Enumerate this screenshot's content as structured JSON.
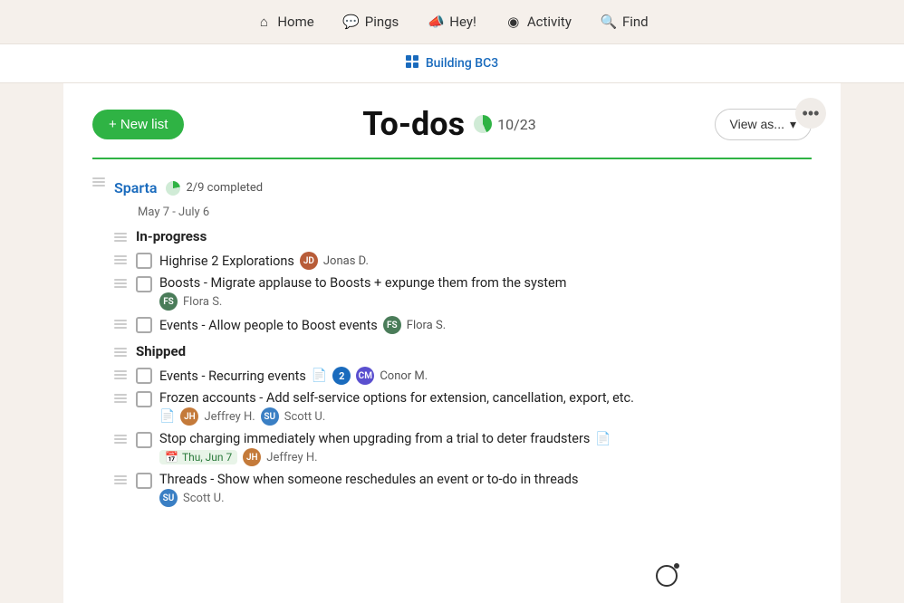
{
  "nav": {
    "items": [
      {
        "id": "home",
        "label": "Home",
        "icon": "home"
      },
      {
        "id": "pings",
        "label": "Pings",
        "icon": "pings"
      },
      {
        "id": "hey",
        "label": "Hey!",
        "icon": "hey"
      },
      {
        "id": "activity",
        "label": "Activity",
        "icon": "activity"
      },
      {
        "id": "find",
        "label": "Find",
        "icon": "find"
      }
    ]
  },
  "breadcrumb": {
    "label": "Building BC3",
    "href": "#"
  },
  "header": {
    "new_list_label": "+ New list",
    "title": "To-dos",
    "progress_text": "10/23",
    "view_as_label": "View as..."
  },
  "sparta": {
    "name": "Sparta",
    "progress_text": "2/9 completed",
    "date_range": "May 7 - July 6"
  },
  "sections": [
    {
      "id": "in-progress",
      "label": "In-progress",
      "items": [
        {
          "id": "item-1",
          "text": "Highrise 2 Explorations",
          "assignee": "Jonas D.",
          "avatar_color": "#b85c38",
          "avatar_initials": "JD",
          "sub": null,
          "has_doc": false,
          "badge": null
        },
        {
          "id": "item-2",
          "text": "Boosts - Migrate applause to Boosts + expunge them from the system",
          "assignee": "Flora S.",
          "avatar_color": "#4a7c59",
          "avatar_initials": "FS",
          "sub": null,
          "has_doc": false,
          "badge": null
        },
        {
          "id": "item-3",
          "text": "Events - Allow people to Boost events",
          "assignee": "Flora S.",
          "avatar_color": "#4a7c59",
          "avatar_initials": "FS",
          "sub": null,
          "has_doc": false,
          "badge": null
        }
      ]
    },
    {
      "id": "shipped",
      "label": "Shipped",
      "items": [
        {
          "id": "item-4",
          "text": "Events - Recurring events",
          "assignee": "Conor M.",
          "avatar_color": "#5a4fcf",
          "avatar_initials": "CM",
          "has_doc": true,
          "badge": "2"
        },
        {
          "id": "item-5",
          "text": "Frozen accounts - Add self-service options for extension, cancellation, export, etc.",
          "assignees": [
            {
              "name": "Jeffrey H.",
              "initials": "JH",
              "color": "#c47a3a"
            },
            {
              "name": "Scott U.",
              "initials": "SU",
              "color": "#3a7fc4"
            }
          ],
          "has_doc": true,
          "badge": null
        },
        {
          "id": "item-6",
          "text": "Stop charging immediately when upgrading from a trial to deter fraudsters",
          "assignee": "Jeffrey H.",
          "avatar_color": "#c47a3a",
          "avatar_initials": "JH",
          "has_doc": true,
          "date_chip": "Thu, Jun 7",
          "badge": null
        },
        {
          "id": "item-7",
          "text": "Threads - Show when someone reschedules an event or to-do in threads",
          "assignee": "Scott U.",
          "avatar_color": "#3a7fc4",
          "avatar_initials": "SU",
          "has_doc": false,
          "badge": null
        }
      ]
    }
  ]
}
